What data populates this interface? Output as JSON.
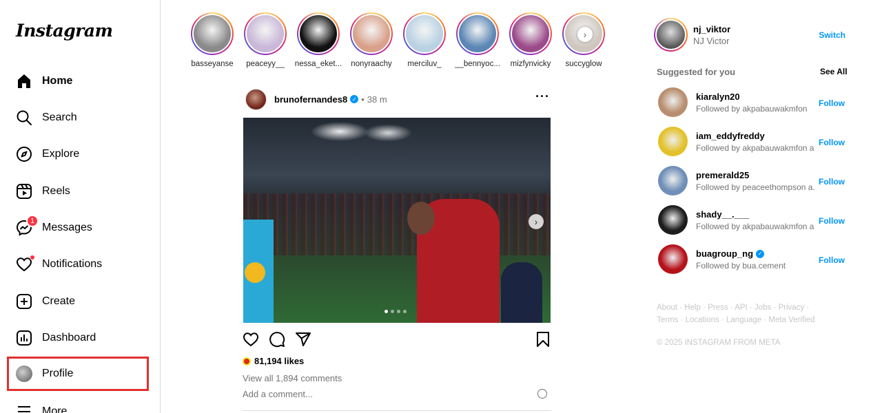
{
  "brand": {
    "logo_text": "Instagram"
  },
  "nav": {
    "home": "Home",
    "search": "Search",
    "explore": "Explore",
    "reels": "Reels",
    "messages": "Messages",
    "messages_badge": "1",
    "notifications": "Notifications",
    "create": "Create",
    "dashboard": "Dashboard",
    "profile": "Profile",
    "more": "More"
  },
  "stories": [
    {
      "name": "basseyanse",
      "color": "#8a8a8a"
    },
    {
      "name": "peaceyy__",
      "color": "#c9b8d8"
    },
    {
      "name": "nessa_eket...",
      "color": "#111111"
    },
    {
      "name": "nonyraachy",
      "color": "#d9a08a"
    },
    {
      "name": "merciluv_",
      "color": "#b9d2e3"
    },
    {
      "name": "__bennyoc...",
      "color": "#5b86b5"
    },
    {
      "name": "mizfynvicky",
      "color": "#9b4a8a"
    },
    {
      "name": "succyglow",
      "color": "#cfc7bf"
    }
  ],
  "post": {
    "username": "brunofernandes8",
    "separator": "•",
    "time": "38 m",
    "likes": "81,194 likes",
    "comments_link": "View all 1,894 comments",
    "comment_placeholder": "Add a comment...",
    "carousel_index": 1,
    "carousel_total": 4
  },
  "me": {
    "username": "nj_viktor",
    "name": "NJ Victor",
    "switch": "Switch"
  },
  "suggestions": {
    "title": "Suggested for you",
    "see_all": "See All",
    "follow_label": "Follow",
    "items": [
      {
        "username": "kiaralyn20",
        "sub": "Followed by akpabauwakmfon",
        "color": "#b88e6f",
        "verified": false
      },
      {
        "username": "iam_eddyfreddy",
        "sub": "Followed by akpabauwakmfon a...",
        "color": "#e3c12a",
        "verified": false
      },
      {
        "username": "premerald25",
        "sub": "Followed by peaceethompson a...",
        "color": "#6f8fb8",
        "verified": false
      },
      {
        "username": "shady__.___",
        "sub": "Followed by akpabauwakmfon a...",
        "color": "#1d1d1d",
        "verified": false
      },
      {
        "username": "buagroup_ng",
        "sub": "Followed by bua.cement",
        "color": "#b5121b",
        "verified": true
      }
    ]
  },
  "footer": {
    "links": [
      "About",
      "Help",
      "Press",
      "API",
      "Jobs",
      "Privacy",
      "Terms",
      "Locations",
      "Language",
      "Meta Verified"
    ],
    "copyright": "© 2025 INSTAGRAM FROM META"
  }
}
